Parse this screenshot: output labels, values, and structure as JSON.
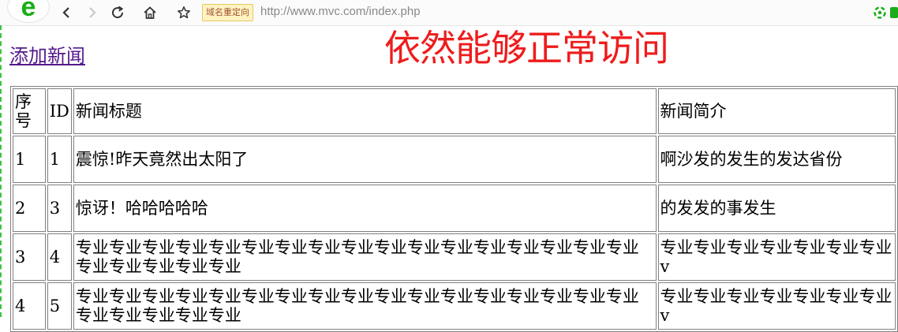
{
  "browser": {
    "logo_letter": "e",
    "redirect_badge": "域名重定向",
    "url_host": "http://www.mvc.com",
    "url_path": "/index.php",
    "icons": [
      "back-arrow-icon",
      "forward-arrow-icon",
      "refresh-icon",
      "home-icon",
      "star-icon",
      "extension-icon"
    ]
  },
  "page": {
    "add_link": "添加新闻",
    "overlay_text": "依然能够正常访问"
  },
  "table": {
    "headers": [
      "序号",
      "ID",
      "新闻标题",
      "新闻简介"
    ],
    "rows": [
      {
        "index": "1",
        "id": "1",
        "title": "震惊!昨天竟然出太阳了",
        "summary": "啊沙发的发生的发达省份"
      },
      {
        "index": "2",
        "id": "3",
        "title": "惊讶！哈哈哈哈哈",
        "summary": "的发发的事发生"
      },
      {
        "index": "3",
        "id": "4",
        "title": "专业专业专业专业专业专业专业专业专业专业专业专业专业专业专业专业专业专业专业专业专业专业",
        "summary": "专业专业专业专业专业专业专业v"
      },
      {
        "index": "4",
        "id": "5",
        "title": "专业专业专业专业专业专业专业专业专业专业专业专业专业专业专业专业专业专业专业专业专业专业",
        "summary": "专业专业专业专业专业专业专业v"
      }
    ]
  },
  "colors": {
    "overlay_red": "#ee1c1c",
    "link_visited": "#551a8b",
    "accent_green": "#1aad19"
  }
}
